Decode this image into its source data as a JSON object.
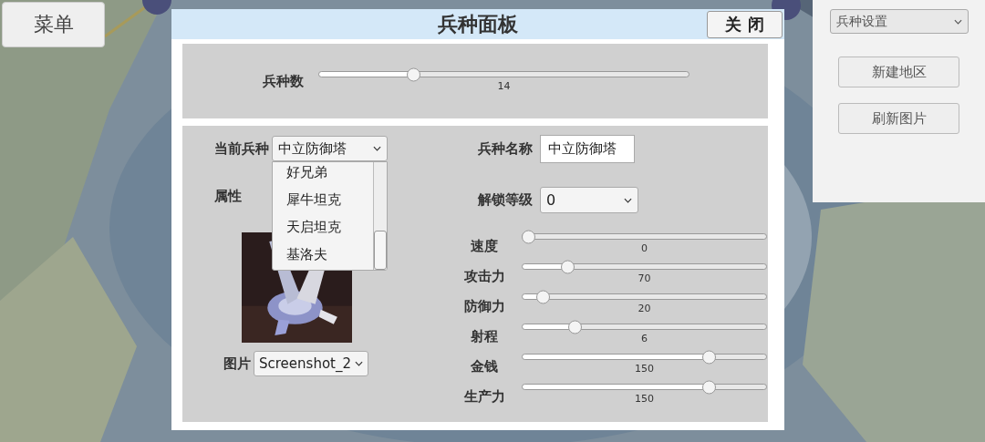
{
  "menu_button": "菜单",
  "panel": {
    "title": "兵种面板",
    "close": "关 闭",
    "unit_count": {
      "label": "兵种数",
      "level": 0.24,
      "reading": "14"
    },
    "current_unit": {
      "label": "当前兵种",
      "value": "中立防御塔",
      "expanded": true,
      "options": [
        "好兄弟",
        "犀牛坦克",
        "天启坦克",
        "基洛夫"
      ]
    },
    "attributes_label": "属性",
    "image_select": {
      "label": "图片",
      "value": "Screenshot_2"
    },
    "unit_name": {
      "label": "兵种名称",
      "value": "中立防御塔"
    },
    "unlock_level": {
      "label": "解锁等级",
      "value": "0"
    },
    "stats": [
      {
        "label": "速度",
        "level": 0,
        "reading": "0"
      },
      {
        "label": "攻击力",
        "level": 0.16,
        "reading": "70"
      },
      {
        "label": "防御力",
        "level": 0.06,
        "reading": "20"
      },
      {
        "label": "射程",
        "level": 0.19,
        "reading": "6"
      },
      {
        "label": "金钱",
        "level": 0.74,
        "reading": "150"
      },
      {
        "label": "生产力",
        "level": 0.74,
        "reading": "150"
      }
    ]
  },
  "side_panel": {
    "dropdown": "兵种设置",
    "buttons": [
      "新建地区",
      "刷新图片"
    ]
  }
}
